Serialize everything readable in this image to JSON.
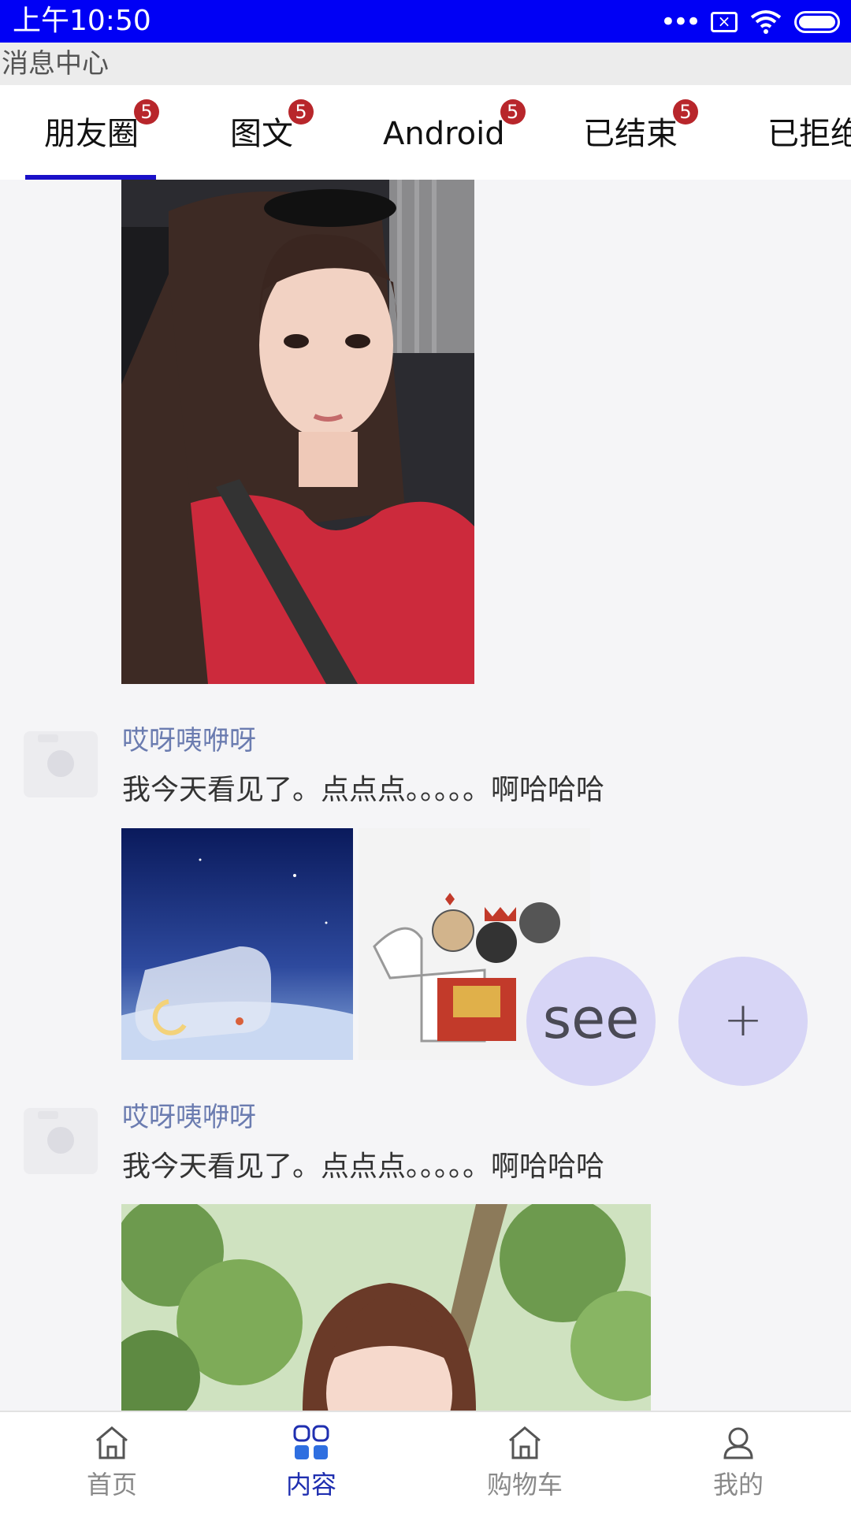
{
  "status_bar": {
    "time": "上午10:50",
    "sim_label": "×"
  },
  "header": {
    "title": "消息中心"
  },
  "tabs": [
    {
      "label": "朋友圈",
      "badge": "5",
      "active": true
    },
    {
      "label": "图文",
      "badge": "5"
    },
    {
      "label": "Android",
      "badge": "5"
    },
    {
      "label": "已结束",
      "badge": "5"
    },
    {
      "label": "已拒绝"
    }
  ],
  "posts": [
    {
      "username": "哎呀咦咿呀",
      "content": "我今天看见了。点点点。。。。。啊哈哈哈"
    },
    {
      "username": "哎呀咦咿呀",
      "content": "我今天看见了。点点点。。。。。啊哈哈哈"
    }
  ],
  "fabs": {
    "see": "see",
    "add": "+"
  },
  "bottom_nav": [
    {
      "label": "首页",
      "icon": "home-icon"
    },
    {
      "label": "内容",
      "icon": "grid-icon",
      "active": true
    },
    {
      "label": "购物车",
      "icon": "cart-icon"
    },
    {
      "label": "我的",
      "icon": "user-icon"
    }
  ],
  "colors": {
    "status_bar": "#0000f5",
    "tab_indicator": "#1a10c8",
    "badge": "#b8262b",
    "username": "#6b7cb0",
    "nav_active": "#1f2fb0",
    "fab": "#d7d5f6"
  }
}
